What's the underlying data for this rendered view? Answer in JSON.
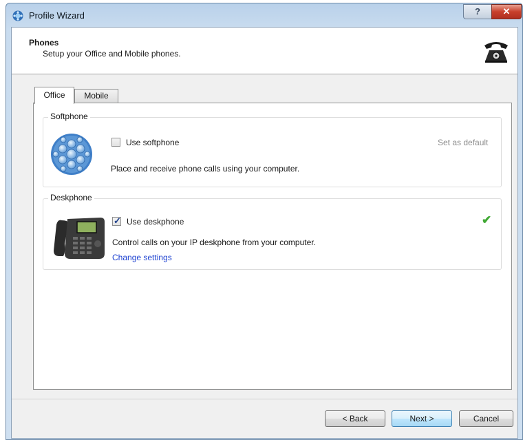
{
  "window": {
    "title": "Profile Wizard",
    "help_glyph": "?",
    "close_glyph": "✕"
  },
  "header": {
    "title": "Phones",
    "subtitle": "Setup your Office and Mobile phones.",
    "icon": "telephone-icon"
  },
  "tabs": [
    {
      "label": "Office",
      "selected": true
    },
    {
      "label": "Mobile",
      "selected": false
    }
  ],
  "softphone": {
    "group_label": "Softphone",
    "checkbox_label": "Use softphone",
    "checked": false,
    "description": "Place and receive phone calls using your computer.",
    "set_default_label": "Set as default",
    "icon": "softphone-globe-icon"
  },
  "deskphone": {
    "group_label": "Deskphone",
    "checkbox_label": "Use deskphone",
    "checked": true,
    "check_glyph": "✓",
    "description": "Control calls on your IP deskphone from your computer.",
    "link_label": "Change settings",
    "status_glyph": "✔",
    "status_color": "#3fa833",
    "icon": "deskphone-icon"
  },
  "buttons": {
    "back": "< Back",
    "next": "Next >",
    "cancel": "Cancel"
  }
}
